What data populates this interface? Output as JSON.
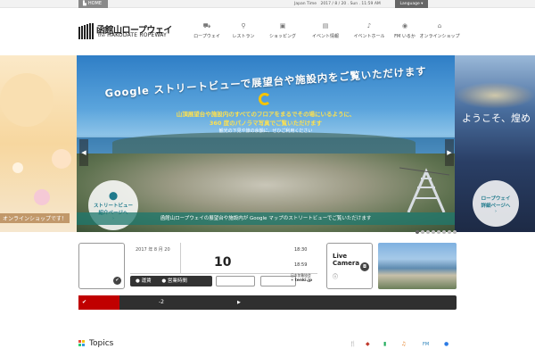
{
  "topbar": {
    "home_label": "HOME",
    "time_text": "Japan Time　2017 / 8 / 20 . Sun . 11:59 AM",
    "language_label": "Language ▾"
  },
  "logo": {
    "jp": "函館山ロープウェイ",
    "en_small": "the",
    "en": "HAKODATE ROPEWAY"
  },
  "nav": [
    {
      "label": "ロープウェイ",
      "icon": "ropeway-icon"
    },
    {
      "label": "レストラン",
      "icon": "restaurant-icon"
    },
    {
      "label": "ショッピング",
      "icon": "shopping-icon"
    },
    {
      "label": "イベント情報",
      "icon": "event-info-icon"
    },
    {
      "label": "イベントホール",
      "icon": "event-hall-icon"
    },
    {
      "label": "FM いるか",
      "icon": "fm-icon"
    },
    {
      "label": "オンラインショップ",
      "icon": "online-shop-icon"
    }
  ],
  "hero": {
    "left_note": "オンラインショップです！",
    "title": "Google ストリートビューで展望台や施設内をご覧いただけます",
    "sub1": "山頂展望台や施設内のすべてのフロアをまるでその場にいるように、",
    "sub2": "360 度のパノラマ写真でご覧いただけます",
    "sub3": "観光の下見や旅の余韻に、ぜひご利用ください",
    "sv_line1": "ストリートビュー",
    "sv_line2": "紹介ページへ",
    "caption": "函館山ロープウェイの展望台や施設内が Google マップのストリートビューでご覧いただけます",
    "right_welcome": "ようこそ、煌め",
    "rw_line1": "ロープウェイ",
    "rw_line2": "詳細ページへ",
    "arrow_left": "◀",
    "arrow_right": "▶",
    "slide_count": 8,
    "active_slide": 0
  },
  "info": {
    "date": "2017 年 8 月 20",
    "day": "10",
    "time1": "18:30",
    "time2": "18:59",
    "btn1": "運賃",
    "btn2": "営業時間",
    "tenki_line1": "日本気象協会",
    "tenki_line2": "tenki.jp",
    "live_line1": "Live",
    "live_line2": "Camera",
    "live_info": "ⓘ"
  },
  "news": {
    "tag": "",
    "text": "-2",
    "arrow": "▶"
  },
  "topics": {
    "title": "Topics",
    "categories": [
      {
        "icon": "fork-icon",
        "color": "#e0a000",
        "glyph": "🍴"
      },
      {
        "icon": "bag-icon",
        "color": "#c0392b",
        "glyph": "◆"
      },
      {
        "icon": "chart-icon",
        "color": "#27ae60",
        "glyph": "▮"
      },
      {
        "icon": "music-icon",
        "color": "#e67e22",
        "glyph": "♫"
      },
      {
        "icon": "fm-icon",
        "color": "#2980b9",
        "glyph": "FM"
      },
      {
        "icon": "speech-icon",
        "color": "#2c7be5",
        "glyph": "●"
      }
    ]
  },
  "colors": {
    "accent_teal": "#1f7a8c",
    "news_red": "#c00000",
    "dark": "#2f2f2f"
  }
}
